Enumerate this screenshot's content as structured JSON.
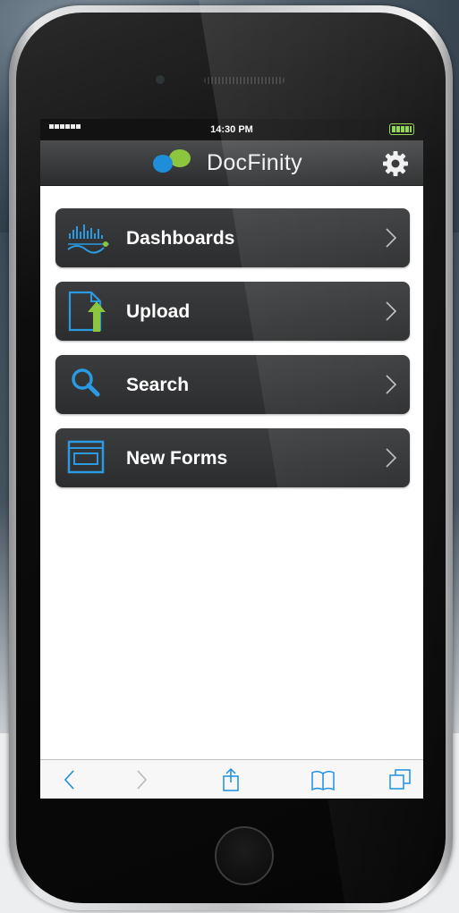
{
  "status_bar": {
    "time": "14:30 PM"
  },
  "app": {
    "brand_name": "DocFinity"
  },
  "menu": {
    "items": [
      {
        "label": "Dashboards",
        "icon": "dashboard-chart-icon"
      },
      {
        "label": "Upload",
        "icon": "upload-document-icon"
      },
      {
        "label": "Search",
        "icon": "search-icon"
      },
      {
        "label": "New Forms",
        "icon": "forms-icon"
      }
    ]
  },
  "toolbar": {
    "buttons": [
      "back-icon",
      "forward-icon",
      "share-icon",
      "bookmarks-icon",
      "tabs-icon"
    ]
  },
  "colors": {
    "accent_blue": "#1f8ed8",
    "accent_green": "#8cc63f",
    "menu_background": "#333435",
    "toolbar_icon": "#1a8fe0"
  }
}
